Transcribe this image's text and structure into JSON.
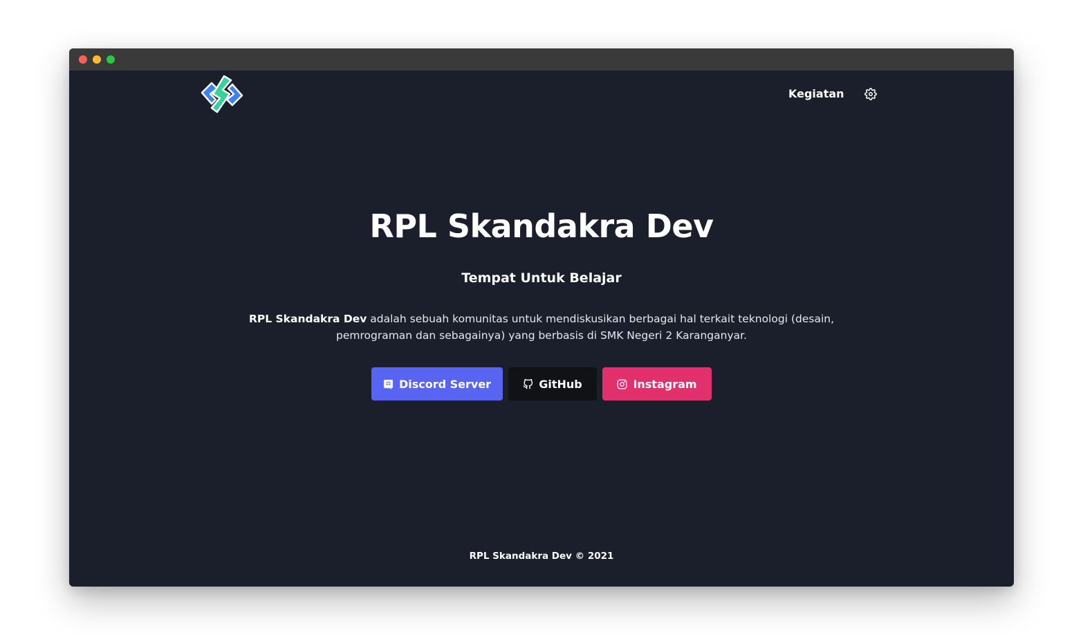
{
  "window": {
    "controls": [
      {
        "name": "close",
        "color": "#ff5f57"
      },
      {
        "name": "minimize",
        "color": "#febc2e"
      },
      {
        "name": "maximize",
        "color": "#28c840"
      }
    ]
  },
  "nav": {
    "logo_icon": "skandakra-logo-icon",
    "links": [
      {
        "label": "Kegiatan"
      }
    ],
    "settings_icon": "gear-icon"
  },
  "hero": {
    "title": "RPL Skandakra Dev",
    "subtitle": "Tempat Untuk Belajar",
    "description_bold": "RPL Skandakra Dev",
    "description_rest": " adalah sebuah komunitas untuk mendiskusikan berbagai hal terkait teknologi (desain, pemrograman dan sebagainya) yang berbasis di SMK Negeri 2 Karanganyar.",
    "buttons": [
      {
        "label": "Discord Server",
        "icon": "discord-icon",
        "color": "#5865f2"
      },
      {
        "label": "GitHub",
        "icon": "github-icon",
        "color": "#111216"
      },
      {
        "label": "Instagram",
        "icon": "instagram-icon",
        "color": "#e1306c"
      }
    ]
  },
  "footer": {
    "text": "RPL Skandakra Dev © 2021"
  },
  "colors": {
    "background": "#1b1f2b",
    "titlebar": "#3a3a3a"
  }
}
